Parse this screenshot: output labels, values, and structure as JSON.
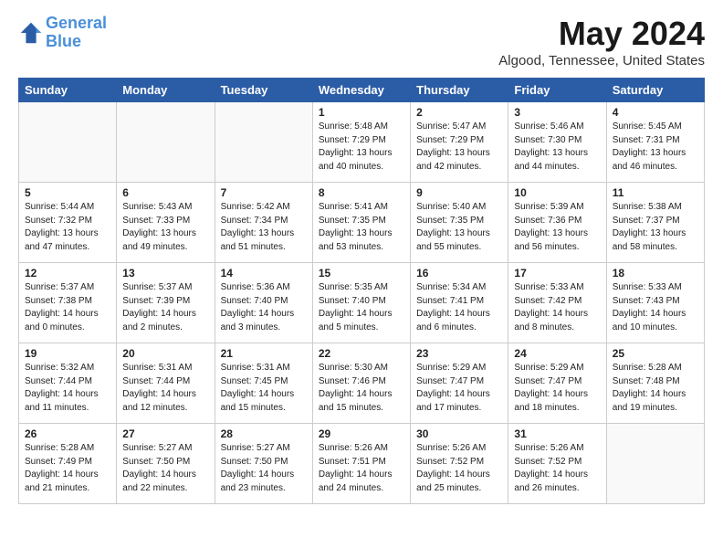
{
  "header": {
    "logo_line1": "General",
    "logo_line2": "Blue",
    "title": "May 2024",
    "subtitle": "Algood, Tennessee, United States"
  },
  "weekdays": [
    "Sunday",
    "Monday",
    "Tuesday",
    "Wednesday",
    "Thursday",
    "Friday",
    "Saturday"
  ],
  "weeks": [
    [
      {
        "day": "",
        "sunrise": "",
        "sunset": "",
        "daylight": ""
      },
      {
        "day": "",
        "sunrise": "",
        "sunset": "",
        "daylight": ""
      },
      {
        "day": "",
        "sunrise": "",
        "sunset": "",
        "daylight": ""
      },
      {
        "day": "1",
        "sunrise": "Sunrise: 5:48 AM",
        "sunset": "Sunset: 7:29 PM",
        "daylight": "Daylight: 13 hours and 40 minutes."
      },
      {
        "day": "2",
        "sunrise": "Sunrise: 5:47 AM",
        "sunset": "Sunset: 7:29 PM",
        "daylight": "Daylight: 13 hours and 42 minutes."
      },
      {
        "day": "3",
        "sunrise": "Sunrise: 5:46 AM",
        "sunset": "Sunset: 7:30 PM",
        "daylight": "Daylight: 13 hours and 44 minutes."
      },
      {
        "day": "4",
        "sunrise": "Sunrise: 5:45 AM",
        "sunset": "Sunset: 7:31 PM",
        "daylight": "Daylight: 13 hours and 46 minutes."
      }
    ],
    [
      {
        "day": "5",
        "sunrise": "Sunrise: 5:44 AM",
        "sunset": "Sunset: 7:32 PM",
        "daylight": "Daylight: 13 hours and 47 minutes."
      },
      {
        "day": "6",
        "sunrise": "Sunrise: 5:43 AM",
        "sunset": "Sunset: 7:33 PM",
        "daylight": "Daylight: 13 hours and 49 minutes."
      },
      {
        "day": "7",
        "sunrise": "Sunrise: 5:42 AM",
        "sunset": "Sunset: 7:34 PM",
        "daylight": "Daylight: 13 hours and 51 minutes."
      },
      {
        "day": "8",
        "sunrise": "Sunrise: 5:41 AM",
        "sunset": "Sunset: 7:35 PM",
        "daylight": "Daylight: 13 hours and 53 minutes."
      },
      {
        "day": "9",
        "sunrise": "Sunrise: 5:40 AM",
        "sunset": "Sunset: 7:35 PM",
        "daylight": "Daylight: 13 hours and 55 minutes."
      },
      {
        "day": "10",
        "sunrise": "Sunrise: 5:39 AM",
        "sunset": "Sunset: 7:36 PM",
        "daylight": "Daylight: 13 hours and 56 minutes."
      },
      {
        "day": "11",
        "sunrise": "Sunrise: 5:38 AM",
        "sunset": "Sunset: 7:37 PM",
        "daylight": "Daylight: 13 hours and 58 minutes."
      }
    ],
    [
      {
        "day": "12",
        "sunrise": "Sunrise: 5:37 AM",
        "sunset": "Sunset: 7:38 PM",
        "daylight": "Daylight: 14 hours and 0 minutes."
      },
      {
        "day": "13",
        "sunrise": "Sunrise: 5:37 AM",
        "sunset": "Sunset: 7:39 PM",
        "daylight": "Daylight: 14 hours and 2 minutes."
      },
      {
        "day": "14",
        "sunrise": "Sunrise: 5:36 AM",
        "sunset": "Sunset: 7:40 PM",
        "daylight": "Daylight: 14 hours and 3 minutes."
      },
      {
        "day": "15",
        "sunrise": "Sunrise: 5:35 AM",
        "sunset": "Sunset: 7:40 PM",
        "daylight": "Daylight: 14 hours and 5 minutes."
      },
      {
        "day": "16",
        "sunrise": "Sunrise: 5:34 AM",
        "sunset": "Sunset: 7:41 PM",
        "daylight": "Daylight: 14 hours and 6 minutes."
      },
      {
        "day": "17",
        "sunrise": "Sunrise: 5:33 AM",
        "sunset": "Sunset: 7:42 PM",
        "daylight": "Daylight: 14 hours and 8 minutes."
      },
      {
        "day": "18",
        "sunrise": "Sunrise: 5:33 AM",
        "sunset": "Sunset: 7:43 PM",
        "daylight": "Daylight: 14 hours and 10 minutes."
      }
    ],
    [
      {
        "day": "19",
        "sunrise": "Sunrise: 5:32 AM",
        "sunset": "Sunset: 7:44 PM",
        "daylight": "Daylight: 14 hours and 11 minutes."
      },
      {
        "day": "20",
        "sunrise": "Sunrise: 5:31 AM",
        "sunset": "Sunset: 7:44 PM",
        "daylight": "Daylight: 14 hours and 12 minutes."
      },
      {
        "day": "21",
        "sunrise": "Sunrise: 5:31 AM",
        "sunset": "Sunset: 7:45 PM",
        "daylight": "Daylight: 14 hours and 15 minutes."
      },
      {
        "day": "22",
        "sunrise": "Sunrise: 5:30 AM",
        "sunset": "Sunset: 7:46 PM",
        "daylight": "Daylight: 14 hours and 15 minutes."
      },
      {
        "day": "23",
        "sunrise": "Sunrise: 5:29 AM",
        "sunset": "Sunset: 7:47 PM",
        "daylight": "Daylight: 14 hours and 17 minutes."
      },
      {
        "day": "24",
        "sunrise": "Sunrise: 5:29 AM",
        "sunset": "Sunset: 7:47 PM",
        "daylight": "Daylight: 14 hours and 18 minutes."
      },
      {
        "day": "25",
        "sunrise": "Sunrise: 5:28 AM",
        "sunset": "Sunset: 7:48 PM",
        "daylight": "Daylight: 14 hours and 19 minutes."
      }
    ],
    [
      {
        "day": "26",
        "sunrise": "Sunrise: 5:28 AM",
        "sunset": "Sunset: 7:49 PM",
        "daylight": "Daylight: 14 hours and 21 minutes."
      },
      {
        "day": "27",
        "sunrise": "Sunrise: 5:27 AM",
        "sunset": "Sunset: 7:50 PM",
        "daylight": "Daylight: 14 hours and 22 minutes."
      },
      {
        "day": "28",
        "sunrise": "Sunrise: 5:27 AM",
        "sunset": "Sunset: 7:50 PM",
        "daylight": "Daylight: 14 hours and 23 minutes."
      },
      {
        "day": "29",
        "sunrise": "Sunrise: 5:26 AM",
        "sunset": "Sunset: 7:51 PM",
        "daylight": "Daylight: 14 hours and 24 minutes."
      },
      {
        "day": "30",
        "sunrise": "Sunrise: 5:26 AM",
        "sunset": "Sunset: 7:52 PM",
        "daylight": "Daylight: 14 hours and 25 minutes."
      },
      {
        "day": "31",
        "sunrise": "Sunrise: 5:26 AM",
        "sunset": "Sunset: 7:52 PM",
        "daylight": "Daylight: 14 hours and 26 minutes."
      },
      {
        "day": "",
        "sunrise": "",
        "sunset": "",
        "daylight": ""
      }
    ]
  ]
}
